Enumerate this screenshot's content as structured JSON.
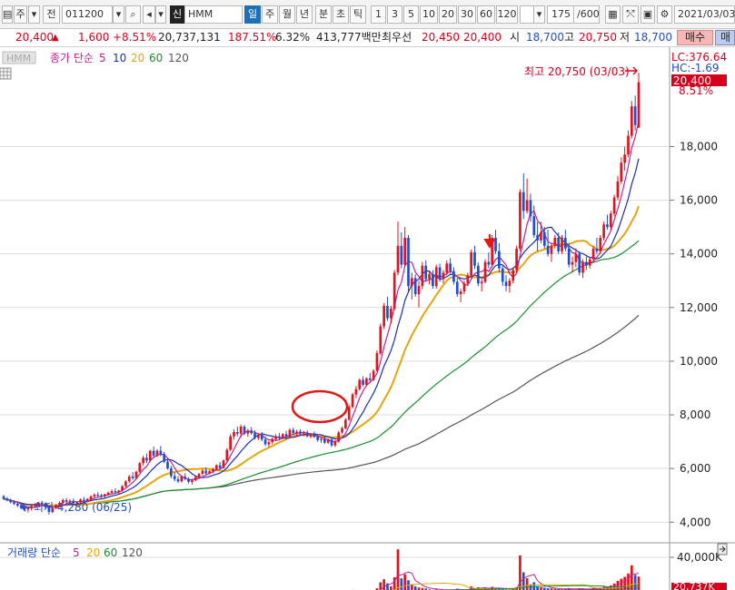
{
  "toolbar": {
    "market": "주",
    "code_label": "전",
    "code": "011200",
    "name_tag": "신",
    "name": "HMM",
    "periods": [
      "일",
      "주",
      "월",
      "년",
      "분",
      "초",
      "틱"
    ],
    "active_period": "일",
    "intervals": [
      "1",
      "3",
      "5",
      "10",
      "20",
      "30",
      "60",
      "120"
    ],
    "range_count": "175",
    "range_total": "/600",
    "date": "2021/03/03"
  },
  "quote": {
    "price": "20,400",
    "arrow": "▲",
    "change": "1,600",
    "change_pct": "+8.51%",
    "volume": "20,737,131",
    "volume_ratio": "187.51%",
    "turnover": "6.32%",
    "amount": "413,777백만",
    "best_label": "최우선",
    "best_ask": "20,450",
    "best_bid": "20,400",
    "open_label": "시",
    "open": "18,700",
    "high_label": "고",
    "high": "20,750",
    "low_label": "저",
    "low": "18,700",
    "buy_label": "매수",
    "sell_label": "매"
  },
  "price_pane": {
    "legend_box": "HMM",
    "legend_label": "종가 단순",
    "ma_periods": [
      "5",
      "10",
      "20",
      "60",
      "120"
    ],
    "ma_colors": [
      "#c0209a",
      "#1a2fb0",
      "#e6a50a",
      "#18902c",
      "#555555"
    ],
    "high_annotation": "최고 20,750 (03/03)",
    "low_annotation": "최저 4,280 (06/25)",
    "lc": "LC:376.64",
    "hc": "HC:-1.69",
    "last_price": "20,400",
    "last_pct": "8.51%",
    "y_ticks": [
      "18,000",
      "16,000",
      "14,000",
      "12,000",
      "10,000",
      "8,000",
      "6,000",
      "4,000"
    ]
  },
  "volume_pane": {
    "legend_label": "거래량 단순",
    "ma_periods": [
      "5",
      "20",
      "60",
      "120"
    ],
    "ma_colors": [
      "#c0209a",
      "#e6a50a",
      "#18902c",
      "#555555"
    ],
    "y_tick": "40,000K",
    "last_value": "20,737K"
  },
  "chart_data": {
    "type": "candlestick",
    "title": "HMM",
    "ylim": [
      3400,
      21500
    ],
    "y_ticks": [
      4000,
      6000,
      8000,
      10000,
      12000,
      14000,
      16000,
      18000
    ],
    "colors": {
      "up": "#e0141e",
      "down": "#1d4fd0"
    },
    "ohlc": [
      [
        4960,
        5020,
        4830,
        4870
      ],
      [
        4880,
        4940,
        4770,
        4820
      ],
      [
        4830,
        4880,
        4700,
        4740
      ],
      [
        4750,
        4820,
        4640,
        4680
      ],
      [
        4690,
        4760,
        4560,
        4620
      ],
      [
        4630,
        4700,
        4480,
        4530
      ],
      [
        4540,
        4610,
        4400,
        4470
      ],
      [
        4470,
        4560,
        4360,
        4520
      ],
      [
        4520,
        4620,
        4440,
        4600
      ],
      [
        4600,
        4700,
        4520,
        4650
      ],
      [
        4650,
        4760,
        4580,
        4720
      ],
      [
        4720,
        4800,
        4620,
        4680
      ],
      [
        4680,
        4740,
        4500,
        4560
      ],
      [
        4560,
        4610,
        4280,
        4380
      ],
      [
        4380,
        4560,
        4330,
        4520
      ],
      [
        4520,
        4680,
        4480,
        4640
      ],
      [
        4640,
        4780,
        4580,
        4720
      ],
      [
        4720,
        4880,
        4660,
        4820
      ],
      [
        4820,
        4900,
        4700,
        4760
      ],
      [
        4760,
        4860,
        4660,
        4800
      ],
      [
        4800,
        4880,
        4660,
        4700
      ],
      [
        4700,
        4780,
        4600,
        4740
      ],
      [
        4740,
        4880,
        4700,
        4840
      ],
      [
        4840,
        4940,
        4760,
        4800
      ],
      [
        4800,
        4900,
        4740,
        4860
      ],
      [
        4860,
        5000,
        4800,
        4960
      ],
      [
        4960,
        5080,
        4880,
        5020
      ],
      [
        5020,
        5120,
        4940,
        5000
      ],
      [
        5000,
        5060,
        4900,
        4960
      ],
      [
        4960,
        5060,
        4900,
        5040
      ],
      [
        5040,
        5140,
        4980,
        5100
      ],
      [
        5100,
        5220,
        5040,
        5160
      ],
      [
        5160,
        5260,
        5060,
        5120
      ],
      [
        5120,
        5200,
        5040,
        5180
      ],
      [
        5180,
        5380,
        5140,
        5340
      ],
      [
        5340,
        5560,
        5300,
        5520
      ],
      [
        5520,
        5760,
        5460,
        5700
      ],
      [
        5700,
        5860,
        5580,
        5640
      ],
      [
        5640,
        5920,
        5600,
        5880
      ],
      [
        5880,
        6240,
        5840,
        6200
      ],
      [
        6200,
        6480,
        6100,
        6400
      ],
      [
        6400,
        6560,
        6200,
        6300
      ],
      [
        6300,
        6700,
        6240,
        6660
      ],
      [
        6660,
        6820,
        6400,
        6480
      ],
      [
        6480,
        6720,
        6420,
        6660
      ],
      [
        6660,
        6840,
        6460,
        6540
      ],
      [
        6540,
        6620,
        6200,
        6260
      ],
      [
        6260,
        6360,
        5960,
        6000
      ],
      [
        6000,
        6100,
        5640,
        5720
      ],
      [
        5720,
        5860,
        5520,
        5600
      ],
      [
        5600,
        5720,
        5460,
        5520
      ],
      [
        5520,
        5760,
        5480,
        5700
      ],
      [
        5700,
        5820,
        5560,
        5620
      ],
      [
        5620,
        5680,
        5440,
        5500
      ],
      [
        5500,
        5620,
        5400,
        5560
      ],
      [
        5560,
        5720,
        5520,
        5680
      ],
      [
        5680,
        5840,
        5620,
        5800
      ],
      [
        5800,
        5980,
        5740,
        5920
      ],
      [
        5920,
        6040,
        5760,
        5820
      ],
      [
        5820,
        5940,
        5780,
        5900
      ],
      [
        5900,
        6020,
        5820,
        5980
      ],
      [
        5980,
        6160,
        5920,
        6120
      ],
      [
        6120,
        6240,
        5960,
        6020
      ],
      [
        6020,
        6340,
        6000,
        6300
      ],
      [
        6300,
        6760,
        6260,
        6700
      ],
      [
        6700,
        7280,
        6640,
        7200
      ],
      [
        7200,
        7460,
        7080,
        7360
      ],
      [
        7360,
        7560,
        7200,
        7300
      ],
      [
        7300,
        7640,
        7160,
        7560
      ],
      [
        7560,
        7620,
        7240,
        7300
      ],
      [
        7300,
        7480,
        7180,
        7420
      ],
      [
        7420,
        7540,
        7260,
        7320
      ],
      [
        7320,
        7420,
        7080,
        7140
      ],
      [
        7140,
        7320,
        7060,
        7260
      ],
      [
        7260,
        7360,
        7020,
        7080
      ],
      [
        7080,
        7200,
        6840,
        6900
      ],
      [
        6900,
        7040,
        6800,
        6980
      ],
      [
        6980,
        7160,
        6900,
        7100
      ],
      [
        7100,
        7280,
        7020,
        7200
      ],
      [
        7200,
        7320,
        7080,
        7140
      ],
      [
        7140,
        7320,
        7100,
        7280
      ],
      [
        7280,
        7400,
        7120,
        7180
      ],
      [
        7180,
        7500,
        7160,
        7440
      ],
      [
        7440,
        7520,
        7260,
        7320
      ],
      [
        7320,
        7440,
        7200,
        7380
      ],
      [
        7380,
        7460,
        7240,
        7300
      ],
      [
        7300,
        7400,
        7200,
        7340
      ],
      [
        7340,
        7420,
        7160,
        7200
      ],
      [
        7200,
        7320,
        7120,
        7260
      ],
      [
        7260,
        7380,
        7140,
        7180
      ],
      [
        7180,
        7280,
        7000,
        7060
      ],
      [
        7060,
        7160,
        6960,
        7100
      ],
      [
        7100,
        7200,
        6920,
        6960
      ],
      [
        6960,
        7120,
        6920,
        7080
      ],
      [
        7080,
        7180,
        6800,
        6860
      ],
      [
        6860,
        7060,
        6800,
        7000
      ],
      [
        7000,
        7400,
        6960,
        7340
      ],
      [
        7340,
        7560,
        7300,
        7500
      ],
      [
        7500,
        7880,
        7460,
        7820
      ],
      [
        7820,
        8360,
        7780,
        8300
      ],
      [
        8300,
        8820,
        8240,
        8760
      ],
      [
        8760,
        9080,
        8620,
        8960
      ],
      [
        8960,
        9360,
        8900,
        9300
      ],
      [
        9300,
        9440,
        9060,
        9120
      ],
      [
        9120,
        9400,
        9060,
        9360
      ],
      [
        9360,
        9560,
        9240,
        9300
      ],
      [
        9300,
        9700,
        9260,
        9640
      ],
      [
        9640,
        10400,
        9600,
        10300
      ],
      [
        10300,
        11400,
        10240,
        11300
      ],
      [
        11300,
        12160,
        11200,
        12060
      ],
      [
        12060,
        12400,
        11500,
        11600
      ],
      [
        11600,
        12060,
        11400,
        11960
      ],
      [
        11960,
        13400,
        11900,
        13300
      ],
      [
        13300,
        15200,
        13200,
        14300
      ],
      [
        14300,
        14800,
        13460,
        13600
      ],
      [
        13600,
        15000,
        13500,
        14600
      ],
      [
        14600,
        14700,
        12600,
        12800
      ],
      [
        12800,
        13300,
        12300,
        13100
      ],
      [
        13100,
        13240,
        12400,
        12500
      ],
      [
        12500,
        13000,
        12000,
        12800
      ],
      [
        12800,
        13700,
        12680,
        13560
      ],
      [
        13560,
        13760,
        12960,
        13060
      ],
      [
        13060,
        13360,
        12860,
        13240
      ],
      [
        13240,
        13400,
        12700,
        12800
      ],
      [
        12800,
        13600,
        12700,
        13500
      ],
      [
        13500,
        13640,
        12960,
        13060
      ],
      [
        13060,
        13400,
        12900,
        13300
      ],
      [
        13300,
        13760,
        13200,
        13640
      ],
      [
        13640,
        13840,
        13260,
        13360
      ],
      [
        13360,
        13500,
        12860,
        12960
      ],
      [
        12960,
        13100,
        12400,
        12500
      ],
      [
        12500,
        12700,
        12200,
        12600
      ],
      [
        12600,
        13000,
        12500,
        12900
      ],
      [
        12900,
        13300,
        12800,
        13200
      ],
      [
        13200,
        14160,
        13100,
        14060
      ],
      [
        14060,
        14300,
        13440,
        13560
      ],
      [
        13560,
        13680,
        12800,
        12900
      ],
      [
        12900,
        13060,
        12600,
        12960
      ],
      [
        12960,
        13800,
        12900,
        13700
      ],
      [
        13700,
        14060,
        13460,
        13600
      ],
      [
        13600,
        14700,
        13500,
        14600
      ],
      [
        14600,
        14900,
        14000,
        14100
      ],
      [
        14100,
        14400,
        13300,
        13460
      ],
      [
        13460,
        13600,
        12800,
        12960
      ],
      [
        12960,
        13200,
        12600,
        12800
      ],
      [
        12800,
        13100,
        12560,
        13000
      ],
      [
        13000,
        13500,
        12900,
        13400
      ],
      [
        13400,
        14300,
        13300,
        14200
      ],
      [
        14200,
        16400,
        14100,
        16300
      ],
      [
        16300,
        17000,
        15300,
        15600
      ],
      [
        15600,
        16800,
        15500,
        16000
      ],
      [
        16000,
        16240,
        15200,
        15400
      ],
      [
        15400,
        15800,
        14600,
        14700
      ],
      [
        14700,
        15200,
        14100,
        14500
      ],
      [
        14500,
        15200,
        14400,
        14800
      ],
      [
        14800,
        15000,
        14200,
        14300
      ],
      [
        14300,
        14900,
        13900,
        14000
      ],
      [
        14000,
        14400,
        13700,
        14300
      ],
      [
        14300,
        14700,
        14200,
        14600
      ],
      [
        14600,
        14800,
        14000,
        14100
      ],
      [
        14100,
        14700,
        14000,
        14600
      ],
      [
        14600,
        14900,
        14100,
        14200
      ],
      [
        14200,
        14400,
        13500,
        13600
      ],
      [
        13600,
        13900,
        13300,
        13700
      ],
      [
        13700,
        14200,
        13500,
        14000
      ],
      [
        14000,
        14100,
        13200,
        13300
      ],
      [
        13300,
        13800,
        13100,
        13700
      ],
      [
        13700,
        13900,
        13400,
        13560
      ],
      [
        13560,
        13900,
        13450,
        13800
      ],
      [
        13800,
        14300,
        13700,
        14200
      ],
      [
        14200,
        14600,
        14000,
        14100
      ],
      [
        14100,
        14700,
        14000,
        14600
      ],
      [
        14600,
        15200,
        14500,
        15100
      ],
      [
        15100,
        15460,
        14900,
        15000
      ],
      [
        15000,
        15600,
        14900,
        15500
      ],
      [
        15500,
        16200,
        15400,
        16100
      ],
      [
        16100,
        16900,
        16000,
        16700
      ],
      [
        16700,
        17600,
        16600,
        17400
      ],
      [
        17400,
        18000,
        17100,
        17700
      ],
      [
        17700,
        18600,
        17600,
        18400
      ],
      [
        18400,
        19700,
        18300,
        19500
      ],
      [
        19500,
        19900,
        18600,
        18800
      ],
      [
        18700,
        20750,
        18700,
        20400
      ]
    ],
    "volume_ylim": [
      0,
      60000
    ],
    "volume_ticks": [
      40000
    ],
    "volume": [
      1200,
      1400,
      1300,
      1500,
      1200,
      1300,
      1600,
      1800,
      1300,
      1200,
      1400,
      1500,
      1700,
      2000,
      1500,
      1400,
      1300,
      1200,
      1300,
      1500,
      1400,
      1200,
      1300,
      1400,
      1600,
      1500,
      1300,
      1400,
      1500,
      1600,
      1400,
      1300,
      1500,
      1600,
      1800,
      2000,
      2200,
      2100,
      2300,
      2800,
      3000,
      2500,
      3100,
      2700,
      2400,
      2300,
      2600,
      2800,
      3100,
      2500,
      2200,
      2300,
      2100,
      2000,
      2100,
      2400,
      2600,
      2800,
      2300,
      2200,
      2400,
      2700,
      2500,
      3000,
      3800,
      5600,
      4500,
      3300,
      3600,
      3000,
      2700,
      2500,
      2800,
      2400,
      2500,
      3100,
      2600,
      2800,
      2900,
      2500,
      2600,
      2400,
      3300,
      2600,
      2400,
      2300,
      2600,
      2500,
      2400,
      2200,
      2700,
      2400,
      2600,
      2300,
      2700,
      2300,
      3500,
      3000,
      3900,
      5200,
      7400,
      6000,
      5500,
      4700,
      4300,
      4400,
      5300,
      9000,
      15000,
      18000,
      14000,
      11000,
      20000,
      48000,
      19000,
      23000,
      17000,
      13000,
      11000,
      9800,
      9400,
      8800,
      7900,
      7500,
      8000,
      7200,
      7100,
      7800,
      7400,
      7900,
      8600,
      7300,
      7000,
      7900,
      11000,
      9000,
      10000,
      8000,
      9500,
      8300,
      10500,
      9100,
      8700,
      8400,
      7800,
      7600,
      8200,
      9900,
      42000,
      25000,
      19000,
      13000,
      15000,
      11000,
      10000,
      9500,
      9000,
      8800,
      8500,
      8300,
      8000,
      8600,
      9300,
      8100,
      8000,
      9100,
      8300,
      7800,
      8200,
      9400,
      9100,
      9800,
      10600,
      10200,
      11800,
      13800,
      16500,
      18500,
      20500,
      23800,
      32000,
      22500,
      20737
    ]
  }
}
